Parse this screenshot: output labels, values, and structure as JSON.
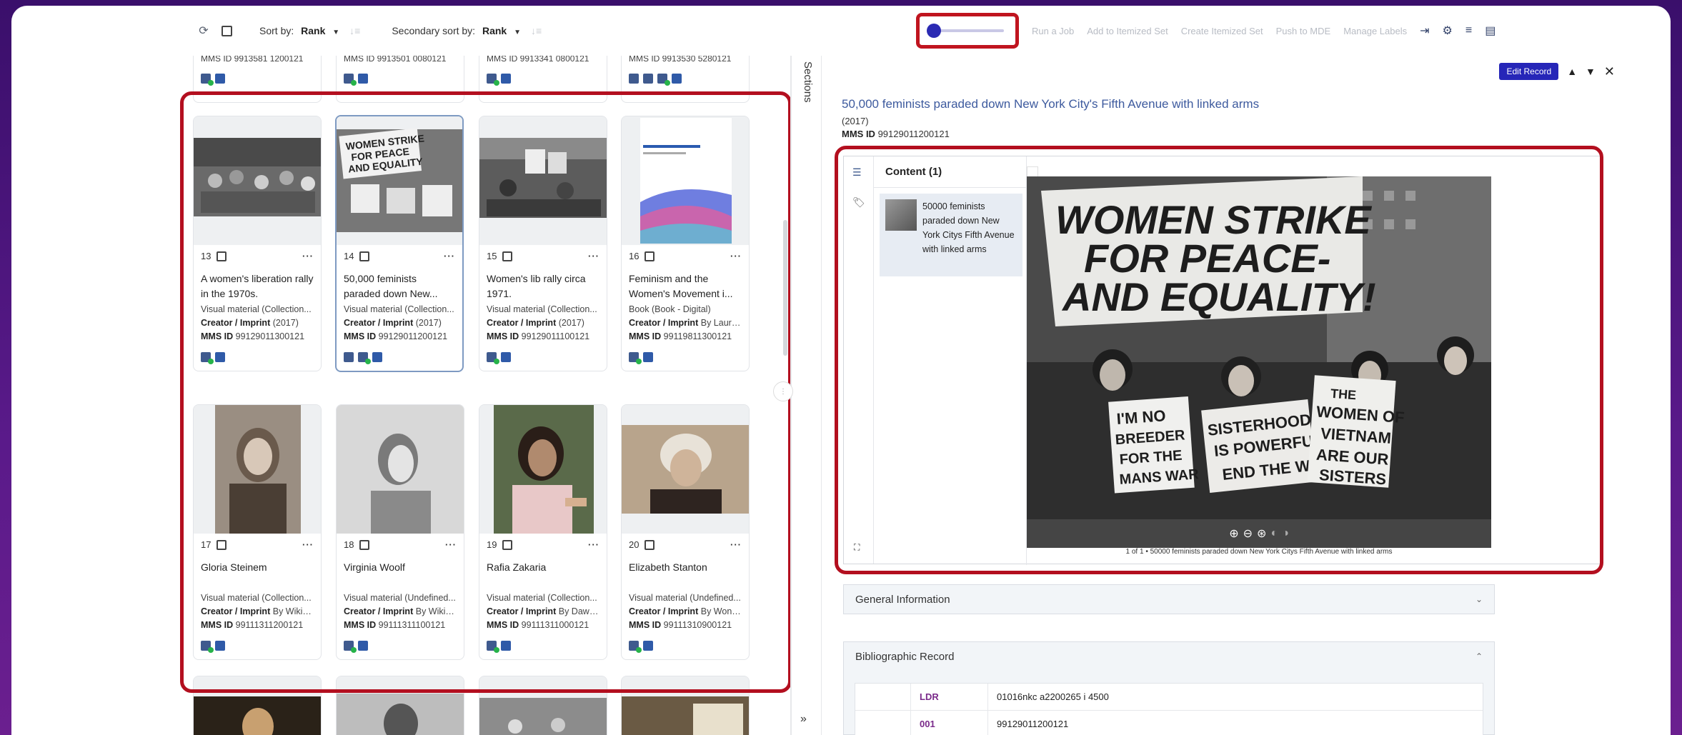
{
  "toolbar": {
    "sort_by_label": "Sort by:",
    "sort_by_value": "Rank",
    "secondary_sort_label": "Secondary sort by:",
    "secondary_sort_value": "Rank",
    "zoom_slider_level": 0.0,
    "actions": [
      "Run a Job",
      "Add to Itemized Set",
      "Create Itemized Set",
      "Push to MDE",
      "Manage Labels"
    ]
  },
  "top_stubs": [
    {
      "mms": "MMS ID 9913581 1200121"
    },
    {
      "mms": "MMS ID 9913501 0080121"
    },
    {
      "mms": "MMS ID 9913341 0800121"
    },
    {
      "mms": "MMS ID 9913530 5280121"
    }
  ],
  "cards": [
    {
      "num": "13",
      "title": "A women's liberation rally in the 1970s.",
      "type": "Visual material (Collection...",
      "creator": "Creator / Imprint",
      "creator_rest": "(2017)",
      "mms_label": "MMS ID",
      "mms": "99129011300121"
    },
    {
      "num": "14",
      "title": "50,000 feminists paraded down New...",
      "type": "Visual material (Collection...",
      "creator": "Creator / Imprint",
      "creator_rest": "(2017)",
      "mms_label": "MMS ID",
      "mms": "99129011200121"
    },
    {
      "num": "15",
      "title": "Women's lib rally circa 1971.",
      "type": "Visual material (Collection...",
      "creator": "Creator / Imprint",
      "creator_rest": "(2017)",
      "mms_label": "MMS ID",
      "mms": "99129011100121"
    },
    {
      "num": "16",
      "title": "Feminism and the Women's Movement i...",
      "type": "Book (Book - Digital)",
      "creator": "Creator / Imprint",
      "creator_rest": "By Laura ...",
      "mms_label": "MMS ID",
      "mms": "99119811300121"
    },
    {
      "num": "17",
      "title": "Gloria Steinem",
      "type": "Visual material (Collection...",
      "creator": "Creator / Imprint",
      "creator_rest": "By Wikipe...",
      "mms_label": "MMS ID",
      "mms": "99111311200121"
    },
    {
      "num": "18",
      "title": "Virginia Woolf",
      "type": "Visual material (Undefined...",
      "creator": "Creator / Imprint",
      "creator_rest": "By Wikipe...",
      "mms_label": "MMS ID",
      "mms": "99111311100121"
    },
    {
      "num": "19",
      "title": "Rafia Zakaria",
      "type": "Visual material (Collection...",
      "creator": "Creator / Imprint",
      "creator_rest": "By Dawn ...",
      "mms_label": "MMS ID",
      "mms": "99111311000121"
    },
    {
      "num": "20",
      "title": "Elizabeth Stanton",
      "type": "Visual material (Undefined...",
      "creator": "Creator / Imprint",
      "creator_rest": "By Wond...",
      "mms_label": "MMS ID",
      "mms": "99111310900121"
    }
  ],
  "sections_label": "Sections",
  "record": {
    "edit_label": "Edit Record",
    "title": "50,000 feminists paraded down New York City's Fifth Avenue with linked arms",
    "year": "(2017)",
    "mms_label": "MMS ID",
    "mms": "99129011200121"
  },
  "viewer": {
    "tab_label": "Content (1)",
    "item_label": "50000 feminists paraded down New York Citys Fifth Avenue with linked arms",
    "caption": "1 of 1 • 50000 feminists paraded down New York Citys Fifth Avenue with linked arms",
    "sign_main": "WOMEN STRIKE FOR PEACE- AND EQUALITY!",
    "sign_left": "I'M NO BREEDER FOR THE MANS WAR",
    "sign_mid": "SISTERHOOD IS POWERFUL END THE WAR!",
    "sign_right": "THE WOMEN OF VIETNAM ARE OUR SISTERS"
  },
  "accordions": {
    "general": "General Information",
    "biblio": "Bibliographic Record"
  },
  "marc": [
    {
      "tag": "LDR",
      "value": "01016nkc a2200265 i 4500"
    },
    {
      "tag": "001",
      "value": "99129011200121"
    }
  ],
  "colors": {
    "accent": "#2626b8",
    "title_link": "#3d5a9e",
    "highlight": "#b30f1f",
    "marc_tag": "#7a2a8a"
  }
}
